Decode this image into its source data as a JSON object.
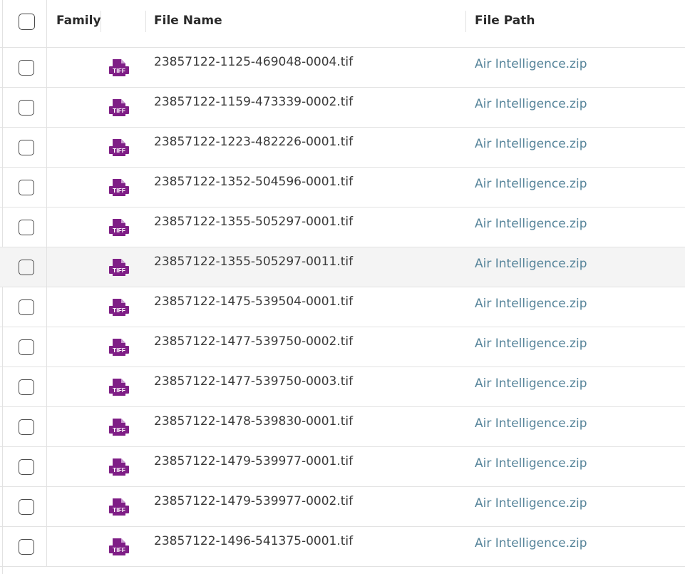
{
  "header": {
    "family_label": "Family",
    "file_name_label": "File Name",
    "file_path_label": "File Path"
  },
  "icon": "tiff-file-icon",
  "colors": {
    "icon": "#7f1e86",
    "link": "#56849a",
    "highlight_row": "#f4f4f4",
    "border": "#e2e2e2"
  },
  "rows": [
    {
      "file_name": "23857122-1125-469048-0004.tif",
      "file_path": "Air Intelligence.zip",
      "icon_label": "TIFF"
    },
    {
      "file_name": "23857122-1159-473339-0002.tif",
      "file_path": "Air Intelligence.zip",
      "icon_label": "TIFF"
    },
    {
      "file_name": "23857122-1223-482226-0001.tif",
      "file_path": "Air Intelligence.zip",
      "icon_label": "TIFF"
    },
    {
      "file_name": "23857122-1352-504596-0001.tif",
      "file_path": "Air Intelligence.zip",
      "icon_label": "TIFF"
    },
    {
      "file_name": "23857122-1355-505297-0001.tif",
      "file_path": "Air Intelligence.zip",
      "icon_label": "TIFF"
    },
    {
      "file_name": "23857122-1355-505297-0011.tif",
      "file_path": "Air Intelligence.zip",
      "icon_label": "TIFF",
      "highlighted": true
    },
    {
      "file_name": "23857122-1475-539504-0001.tif",
      "file_path": "Air Intelligence.zip",
      "icon_label": "TIFF"
    },
    {
      "file_name": "23857122-1477-539750-0002.tif",
      "file_path": "Air Intelligence.zip",
      "icon_label": "TIFF"
    },
    {
      "file_name": "23857122-1477-539750-0003.tif",
      "file_path": "Air Intelligence.zip",
      "icon_label": "TIFF"
    },
    {
      "file_name": "23857122-1478-539830-0001.tif",
      "file_path": "Air Intelligence.zip",
      "icon_label": "TIFF"
    },
    {
      "file_name": "23857122-1479-539977-0001.tif",
      "file_path": "Air Intelligence.zip",
      "icon_label": "TIFF"
    },
    {
      "file_name": "23857122-1479-539977-0002.tif",
      "file_path": "Air Intelligence.zip",
      "icon_label": "TIFF"
    },
    {
      "file_name": "23857122-1496-541375-0001.tif",
      "file_path": "Air Intelligence.zip",
      "icon_label": "TIFF"
    }
  ]
}
